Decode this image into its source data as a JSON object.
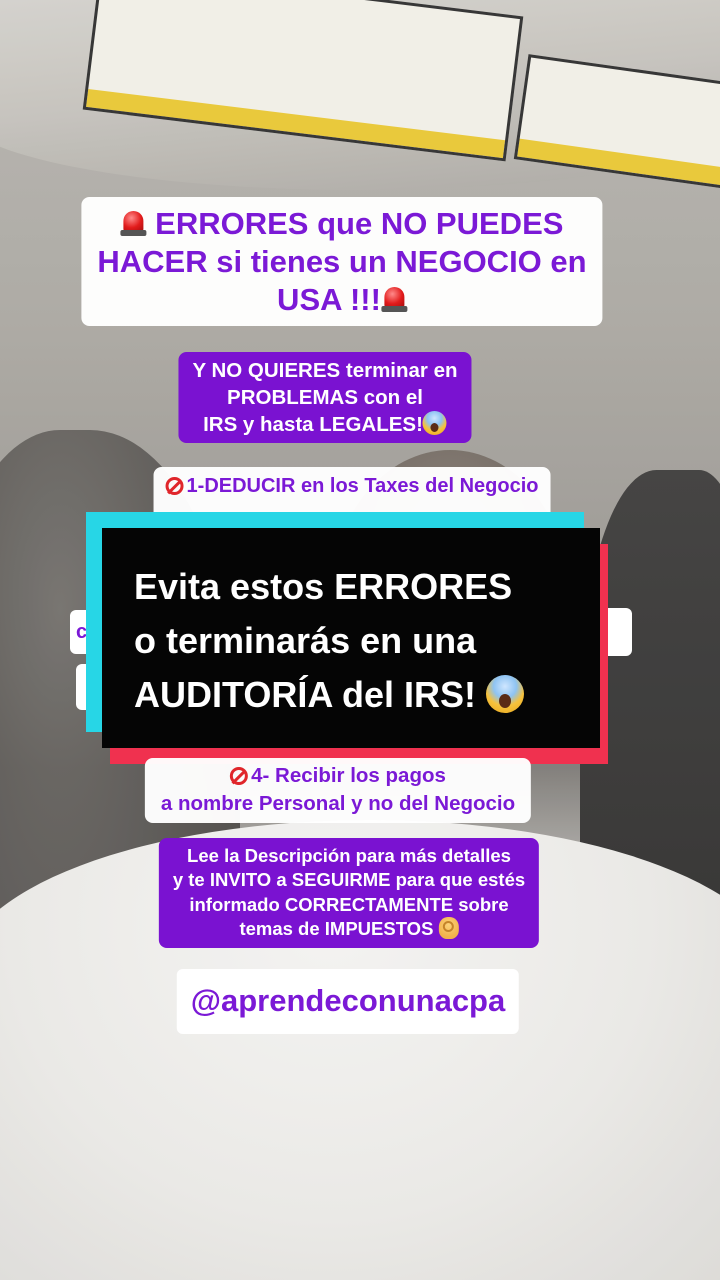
{
  "title": {
    "line1": "ERRORES que NO PUEDES",
    "line2": "HACER si tienes un NEGOCIO en",
    "line3": "USA !!!",
    "emoji": "police-siren"
  },
  "subtitle": {
    "line1": "Y NO QUIERES terminar en",
    "line2": "PROBLEMAS con el",
    "line3": "IRS y hasta LEGALES!",
    "emoji": "screaming-face"
  },
  "error1": {
    "label": "1-DEDUCIR en los Taxes del Negocio",
    "icon": "prohibited"
  },
  "error2_partial": "c",
  "banner": {
    "line1": "Evita estos ERRORES",
    "line2": "o terminarás en una",
    "line3": "AUDITORÍA del IRS!",
    "emoji": "screaming-face",
    "colors": {
      "fill": "#050505",
      "cyan": "#27d6e6",
      "red": "#f0314f"
    }
  },
  "error4": {
    "line1": "4- Recibir los pagos",
    "line2": "a nombre Personal y no del Negocio",
    "icon": "prohibited"
  },
  "cta": {
    "line1": "Lee la Descripción para más detalles",
    "line2": "y te INVITO a SEGUIRME para que estés",
    "line3": "informado CORRECTAMENTE sobre",
    "line4": "temas de IMPUESTOS",
    "emoji": "ok-hand"
  },
  "handle": "@aprendeconunacpa",
  "colors": {
    "accent_purple": "#7a12d1",
    "text_purple": "#7b19d6",
    "white": "#ffffff"
  }
}
